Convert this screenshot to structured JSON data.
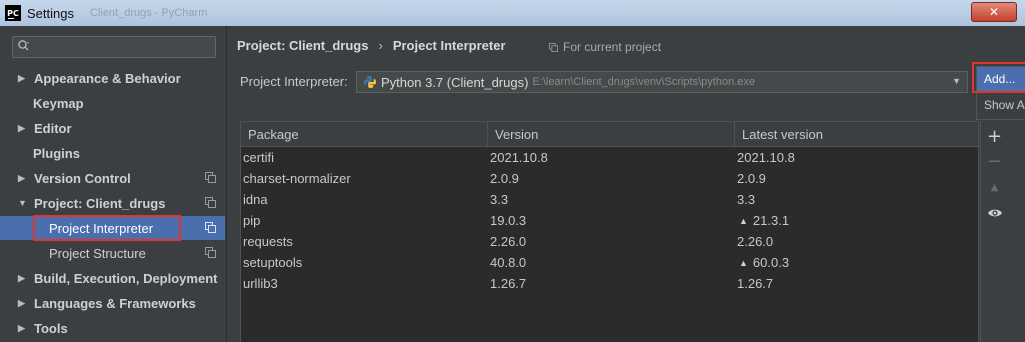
{
  "window": {
    "logo_text": "PC",
    "title": "Settings",
    "ghost_title": "Client_drugs - PyCharm",
    "close_label": "✕"
  },
  "sidebar": {
    "search_placeholder": "",
    "items": [
      {
        "label": "Appearance & Behavior",
        "arrow": "▶"
      },
      {
        "label": "Keymap",
        "arrow": ""
      },
      {
        "label": "Editor",
        "arrow": "▶"
      },
      {
        "label": "Plugins",
        "arrow": ""
      },
      {
        "label": "Version Control",
        "arrow": "▶"
      },
      {
        "label": "Project: Client_drugs",
        "arrow": "▼"
      },
      {
        "label": "Project Interpreter",
        "arrow": ""
      },
      {
        "label": "Project Structure",
        "arrow": ""
      },
      {
        "label": "Build, Execution, Deployment",
        "arrow": "▶"
      },
      {
        "label": "Languages & Frameworks",
        "arrow": "▶"
      },
      {
        "label": "Tools",
        "arrow": "▶"
      }
    ]
  },
  "breadcrumb": {
    "parent": "Project: Client_drugs",
    "separator": "›",
    "current": "Project Interpreter"
  },
  "scope_note": "For current project",
  "interpreter": {
    "label": "Project Interpreter:",
    "name": "Python 3.7 (Client_drugs)",
    "path": "E:\\learn\\Client_drugs\\venv\\Scripts\\python.exe",
    "dropdown_arrow": "▼"
  },
  "add_menu": {
    "add_label": "Add...",
    "show_all_label": "Show All..."
  },
  "table": {
    "headers": [
      "Package",
      "Version",
      "Latest version"
    ],
    "rows": [
      {
        "package": "certifi",
        "version": "2021.10.8",
        "latest": "2021.10.8",
        "upgrade": ""
      },
      {
        "package": "charset-normalizer",
        "version": "2.0.9",
        "latest": "2.0.9",
        "upgrade": ""
      },
      {
        "package": "idna",
        "version": "3.3",
        "latest": "3.3",
        "upgrade": ""
      },
      {
        "package": "pip",
        "version": "19.0.3",
        "latest": "21.3.1",
        "upgrade": "▲"
      },
      {
        "package": "requests",
        "version": "2.26.0",
        "latest": "2.26.0",
        "upgrade": ""
      },
      {
        "package": "setuptools",
        "version": "40.8.0",
        "latest": "60.0.3",
        "upgrade": "▲"
      },
      {
        "package": "urllib3",
        "version": "1.26.7",
        "latest": "1.26.7",
        "upgrade": ""
      }
    ]
  },
  "toolbar": {
    "add_symbol": "+",
    "remove_symbol": "−",
    "upgrade_symbol": "▲"
  },
  "colors": {
    "selection": "#4b6eaf",
    "highlight_box": "#e0342f",
    "panel_bg": "#3c3f41",
    "table_bg": "#2b2b2b"
  }
}
